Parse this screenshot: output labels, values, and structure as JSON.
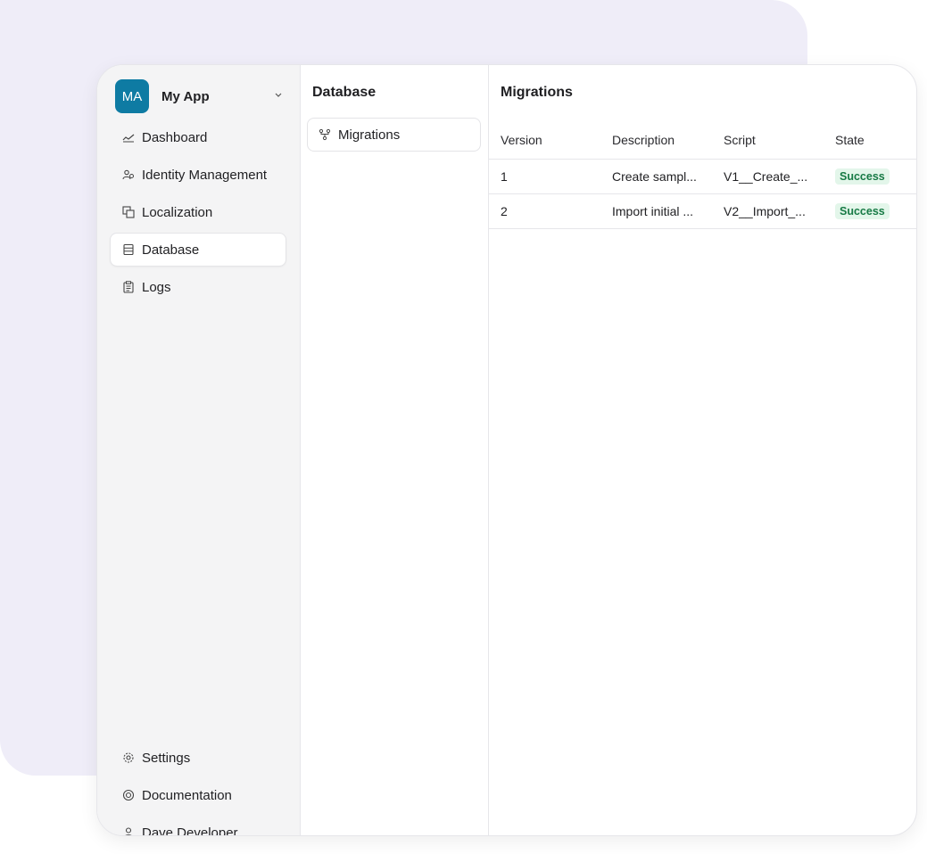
{
  "app": {
    "initials": "MA",
    "name": "My App"
  },
  "sidebar": {
    "items": [
      {
        "label": "Dashboard",
        "icon": "chart-line-icon"
      },
      {
        "label": "Identity Management",
        "icon": "users-icon"
      },
      {
        "label": "Localization",
        "icon": "translate-icon"
      },
      {
        "label": "Database",
        "icon": "database-icon",
        "active": true
      },
      {
        "label": "Logs",
        "icon": "clipboard-icon"
      }
    ],
    "bottom": [
      {
        "label": "Settings",
        "icon": "gear-icon"
      },
      {
        "label": "Documentation",
        "icon": "lifebuoy-icon"
      },
      {
        "label": "Dave Developer",
        "icon": "user-icon"
      }
    ]
  },
  "database": {
    "title": "Database",
    "items": [
      {
        "label": "Migrations",
        "icon": "git-merge-icon"
      }
    ]
  },
  "migrations": {
    "title": "Migrations",
    "columns": [
      "Version",
      "Description",
      "Script",
      "State"
    ],
    "rows": [
      {
        "version": "1",
        "description": "Create sampl...",
        "script": "V1__Create_...",
        "state": "Success"
      },
      {
        "version": "2",
        "description": "Import initial ...",
        "script": "V2__Import_...",
        "state": "Success"
      }
    ]
  },
  "colors": {
    "accent": "#0e7ba3",
    "success_bg": "#e3f6ea",
    "success_fg": "#177a45",
    "backdrop": "#efedf8"
  }
}
